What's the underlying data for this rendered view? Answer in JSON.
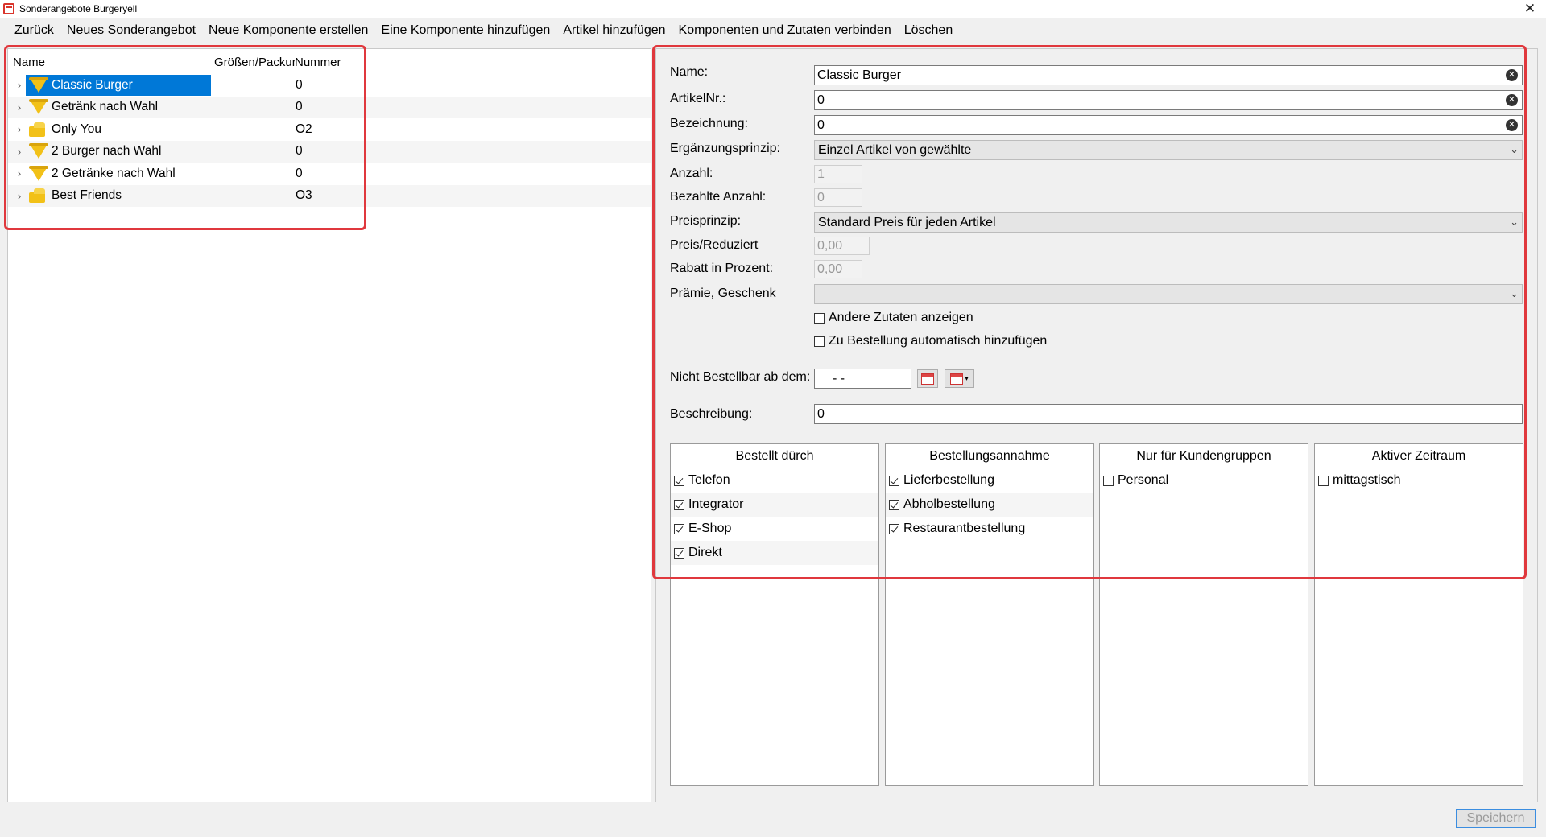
{
  "window": {
    "title": "Sonderangebote Burgeryell",
    "close_glyph": "✕"
  },
  "menu": [
    "Zurück",
    "Neues Sonderangebot",
    "Neue Komponente erstellen",
    "Eine Komponente hinzufügen",
    "Artikel hinzufügen",
    "Komponenten und Zutaten verbinden",
    "Löschen"
  ],
  "tree": {
    "columns": {
      "name": "Name",
      "size": "Größen/Packung",
      "number": "Nummer"
    },
    "rows": [
      {
        "label": "Classic Burger",
        "size": "",
        "number": "0",
        "icon": "pizza-slice-icon",
        "selected": true
      },
      {
        "label": "Getränk nach Wahl",
        "size": "",
        "number": "0",
        "icon": "pizza-slice-icon",
        "selected": false
      },
      {
        "label": "Only You",
        "size": "",
        "number": "O2",
        "icon": "cheese-icon",
        "selected": false
      },
      {
        "label": "2 Burger nach Wahl",
        "size": "",
        "number": "0",
        "icon": "pizza-slice-icon",
        "selected": false
      },
      {
        "label": "2 Getränke nach Wahl",
        "size": "",
        "number": "0",
        "icon": "pizza-slice-icon",
        "selected": false
      },
      {
        "label": "Best Friends",
        "size": "",
        "number": "O3",
        "icon": "cheese-icon",
        "selected": false
      }
    ]
  },
  "form": {
    "name_label": "Name:",
    "name_value": "Classic Burger",
    "artikelnr_label": "ArtikelNr.:",
    "artikelnr_value": "0",
    "bezeichnung_label": "Bezeichnung:",
    "bezeichnung_value": "0",
    "ergaenzung_label": "Ergänzungsprinzip:",
    "ergaenzung_value": "Einzel Artikel von gewählte",
    "anzahl_label": "Anzahl:",
    "anzahl_value": "1",
    "bezahlte_label": "Bezahlte Anzahl:",
    "bezahlte_value": "0",
    "preisprinzip_label": "Preisprinzip:",
    "preisprinzip_value": "Standard Preis für jeden Artikel",
    "preis_label": "Preis/Reduziert",
    "preis_value": "0,00",
    "rabatt_label": "Rabatt in Prozent:",
    "rabatt_value": "0,00",
    "praemie_label": "Prämie, Geschenk",
    "praemie_value": "",
    "andere_zutaten_label": "Andere Zutaten anzeigen",
    "andere_zutaten_checked": false,
    "auto_add_label": "Zu Bestellung automatisch hinzufügen",
    "auto_add_checked": false,
    "nicht_bestellbar_label": "Nicht Bestellbar ab dem:",
    "nicht_bestellbar_value": "-  -",
    "beschreibung_label": "Beschreibung:",
    "beschreibung_value": "0"
  },
  "groups": [
    {
      "title": "Bestellt dürch",
      "items": [
        {
          "label": "Telefon",
          "checked": true
        },
        {
          "label": "Integrator",
          "checked": true
        },
        {
          "label": "E-Shop",
          "checked": true
        },
        {
          "label": "Direkt",
          "checked": true
        }
      ]
    },
    {
      "title": "Bestellungsannahme",
      "items": [
        {
          "label": "Lieferbestellung",
          "checked": true
        },
        {
          "label": "Abholbestellung",
          "checked": true
        },
        {
          "label": "Restaurantbestellung",
          "checked": true
        }
      ]
    },
    {
      "title": "Nur für Kundengruppen",
      "items": [
        {
          "label": "Personal",
          "checked": false
        }
      ]
    },
    {
      "title": "Aktiver Zeitraum",
      "items": [
        {
          "label": "mittagstisch",
          "checked": false
        }
      ]
    }
  ],
  "save_label": "Speichern",
  "colors": {
    "selection": "#0078d7",
    "highlight": "#e0383d",
    "icon_yellow": "#f2c118"
  }
}
